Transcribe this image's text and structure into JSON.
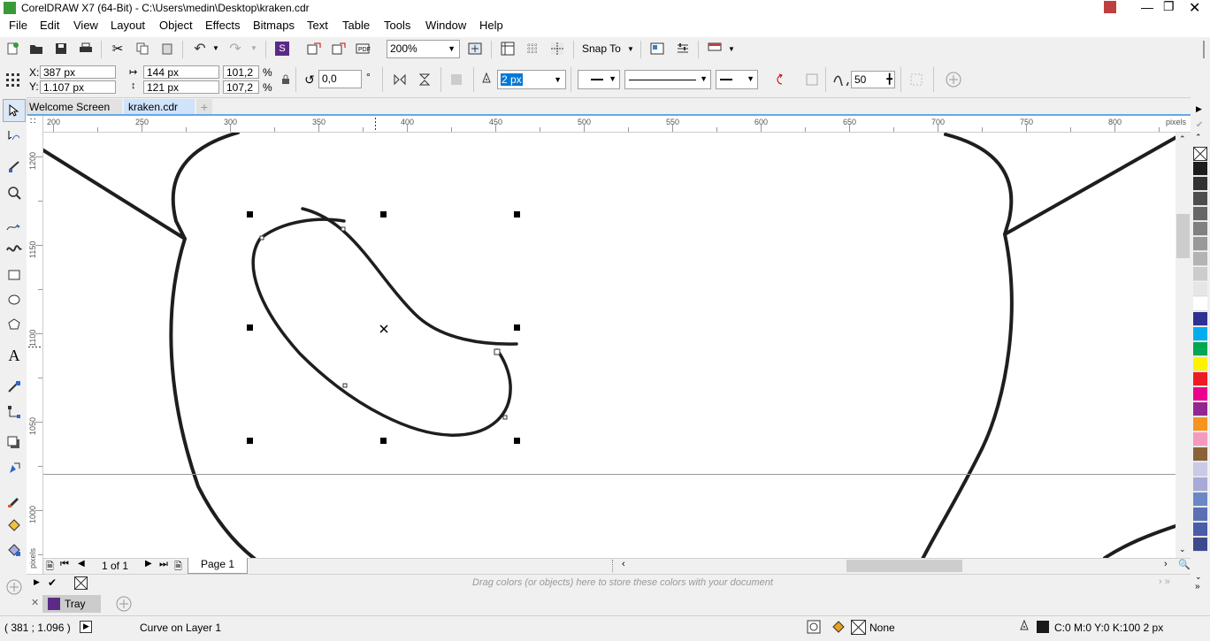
{
  "window": {
    "title": "CorelDRAW X7 (64-Bit) - C:\\Users\\medin\\Desktop\\kraken.cdr"
  },
  "menu": [
    "File",
    "Edit",
    "View",
    "Layout",
    "Object",
    "Effects",
    "Bitmaps",
    "Text",
    "Table",
    "Tools",
    "Window",
    "Help"
  ],
  "toolbar": {
    "zoom": "200%",
    "snap_to": "Snap To"
  },
  "props": {
    "x_label": "X:",
    "x_value": "387 px",
    "y_label": "Y:",
    "y_value": "1.107 px",
    "width": "144 px",
    "height": "121 px",
    "scale_x": "101,2",
    "scale_y": "107,2",
    "pct": "%",
    "rotation": "0,0",
    "degree": "°",
    "outline_width": "2 px",
    "smoothing": "50"
  },
  "tabs": [
    "Welcome Screen",
    "kraken.cdr"
  ],
  "ruler": {
    "h_ticks": [
      "200",
      "250",
      "300",
      "350",
      "400",
      "450",
      "500",
      "550",
      "600",
      "650",
      "700",
      "750",
      "800"
    ],
    "h_unit": "pixels",
    "v_ticks": [
      "1200",
      "1150",
      "1100",
      "1050",
      "1000"
    ],
    "v_unit": "pixels"
  },
  "page_nav": {
    "counter": "1 of 1",
    "page_tab": "Page 1"
  },
  "palette_tray": {
    "hint": "Drag colors (or objects) here to store these colors with your document"
  },
  "tray": {
    "label": "Tray"
  },
  "status": {
    "coords": "( 381  ; 1.096 )",
    "object": "Curve on Layer 1",
    "fill": "None",
    "outline": "C:0 M:0 Y:0 K:100  2 px"
  },
  "colors": {
    "palette": [
      "#1c1c1c",
      "#333333",
      "#4d4d4d",
      "#666666",
      "#808080",
      "#999999",
      "#b3b3b3",
      "#cccccc",
      "#e6e6e6",
      "#ffffff",
      "#2e3192",
      "#00aeef",
      "#00a651",
      "#fff200",
      "#ed1c24",
      "#ec008c",
      "#92278f",
      "#f7941d",
      "#f49ac1",
      "#8c6239",
      "#c9c9e8",
      "#a7a9d6",
      "#6d87c4",
      "#5b6fb5",
      "#4a5ba8",
      "#3c4a8c"
    ],
    "accent": "#0078d7"
  }
}
